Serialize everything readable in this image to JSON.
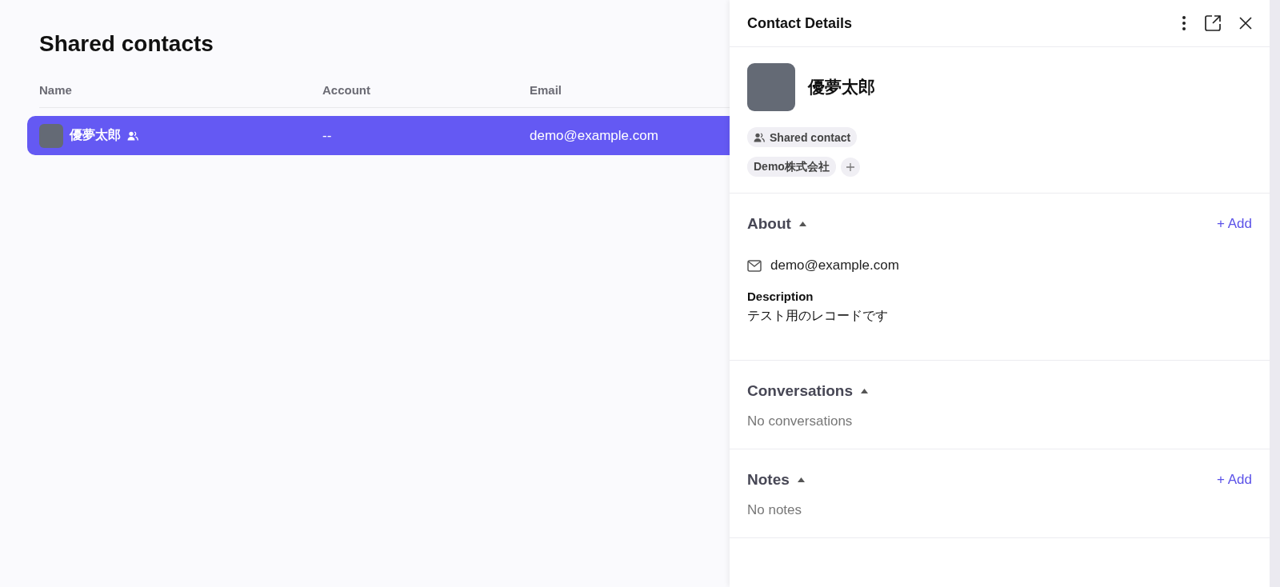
{
  "page": {
    "title": "Shared contacts"
  },
  "table": {
    "columns": [
      "Name",
      "Account",
      "Email"
    ],
    "rows": [
      {
        "name": "優夢太郎",
        "shared": true,
        "account": "--",
        "email": "demo@example.com",
        "selected": true
      }
    ]
  },
  "details": {
    "title": "Contact Details",
    "contact": {
      "name": "優夢太郎"
    },
    "tags": [
      {
        "label": "Shared contact",
        "kind": "shared"
      },
      {
        "label": "Demo株式会社",
        "kind": "company"
      }
    ],
    "sections": [
      {
        "title": "About",
        "expanded": true,
        "add_label": "+ Add",
        "email": "demo@example.com",
        "description_label": "Description",
        "description": "テスト用のレコードです"
      },
      {
        "title": "Conversations",
        "expanded": true,
        "empty_text": "No conversations"
      },
      {
        "title": "Notes",
        "expanded": true,
        "add_label": "+ Add",
        "empty_text": "No notes"
      }
    ]
  }
}
